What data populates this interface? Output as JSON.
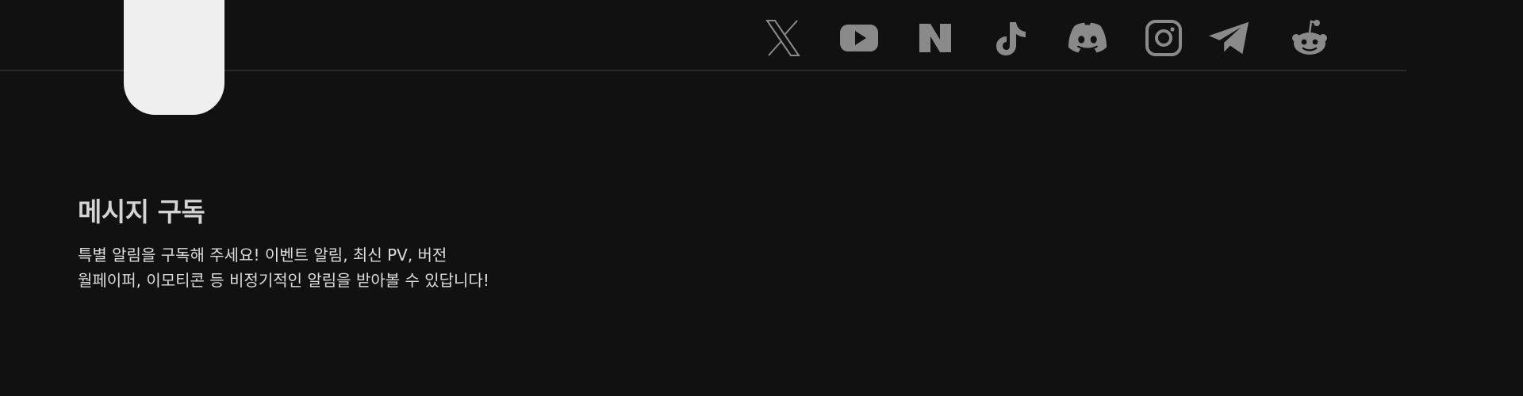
{
  "header": {
    "social_links": [
      {
        "name": "X",
        "icon": "x-icon"
      },
      {
        "name": "YouTube",
        "icon": "youtube-icon"
      },
      {
        "name": "Naver",
        "icon": "naver-icon"
      },
      {
        "name": "TikTok",
        "icon": "tiktok-icon"
      },
      {
        "name": "Discord",
        "icon": "discord-icon"
      },
      {
        "name": "Instagram",
        "icon": "instagram-icon"
      },
      {
        "name": "Telegram",
        "icon": "telegram-icon"
      },
      {
        "name": "Reddit",
        "icon": "reddit-icon"
      }
    ],
    "icon_color": "#8a8a8a"
  },
  "subscribe": {
    "title": "메시지 구독",
    "description_line1": "특별 알림을 구독해 주세요! 이벤트 알림, 최신 PV, 버전",
    "description_line2": "월페이퍼, 이모티콘 등 비정기적인 알림을 받아볼 수 있답니다!"
  },
  "colors": {
    "background": "#111111",
    "divider": "#2a2a2a",
    "tab_shape": "#efefef",
    "title": "#d4d4d4",
    "text": "#dddddd"
  }
}
